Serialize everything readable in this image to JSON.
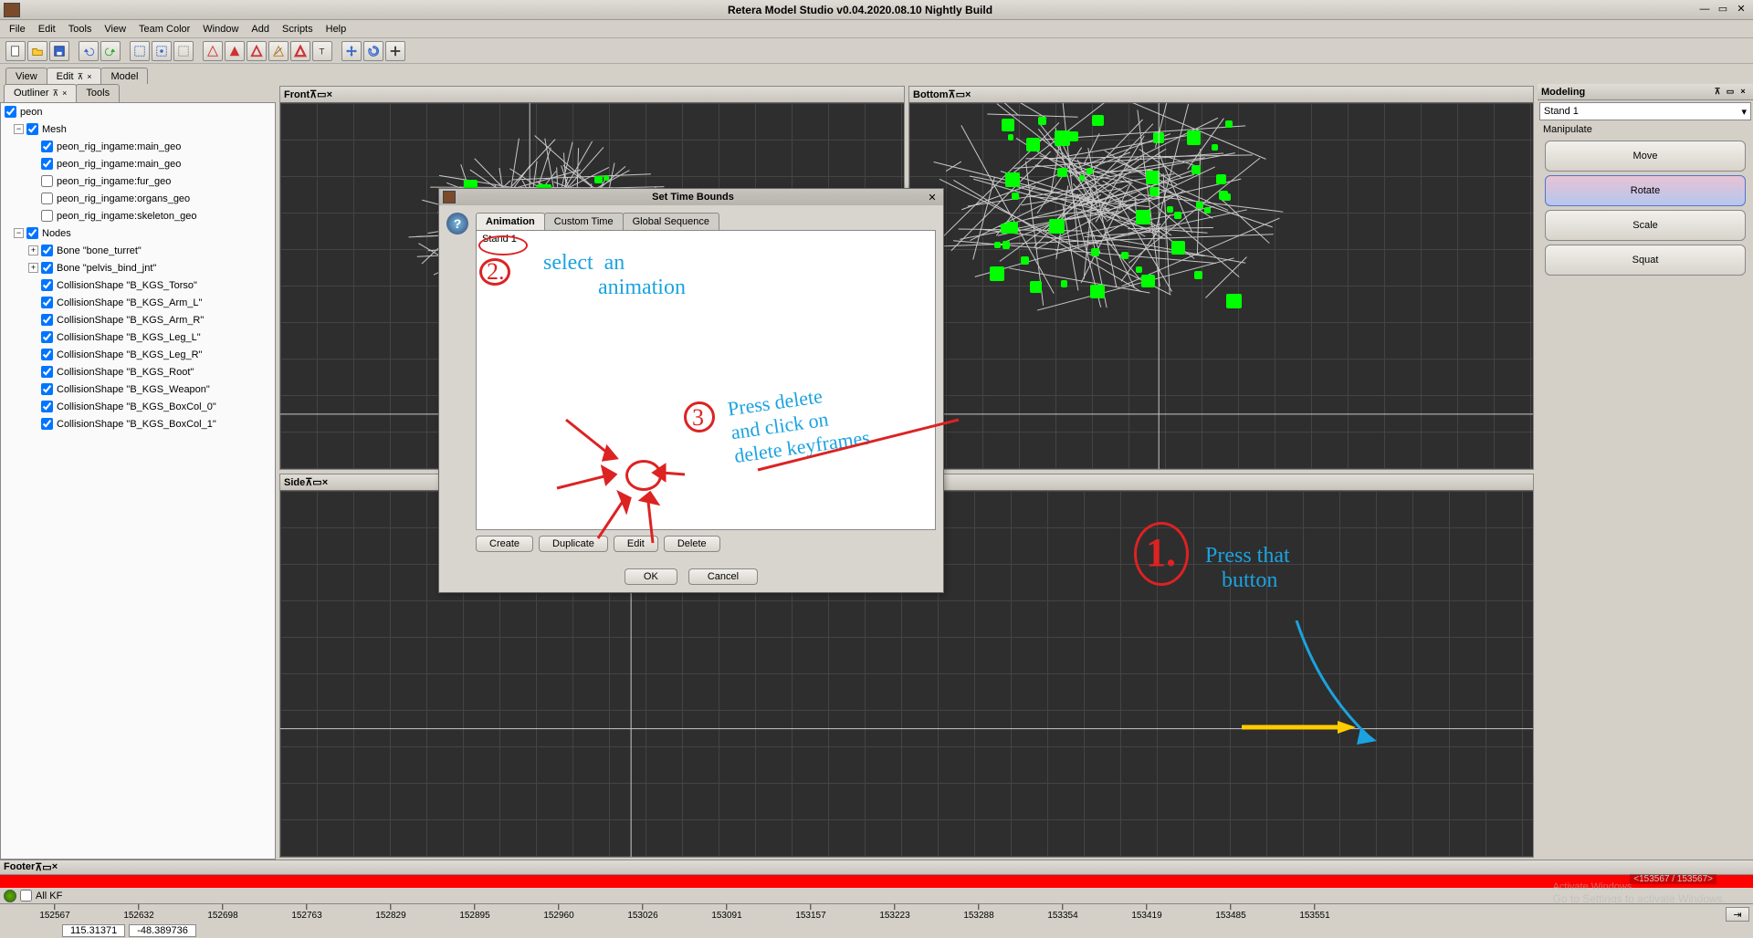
{
  "title": "Retera Model Studio v0.04.2020.08.10 Nightly Build",
  "menu": [
    "File",
    "Edit",
    "Tools",
    "View",
    "Team Color",
    "Window",
    "Add",
    "Scripts",
    "Help"
  ],
  "topTabs": {
    "view": "View",
    "edit": "Edit",
    "model": "Model"
  },
  "leftTabs": {
    "outliner": "Outliner",
    "tools": "Tools"
  },
  "outliner": {
    "root": "peon",
    "mesh": "Mesh",
    "meshItems": [
      "peon_rig_ingame:main_geo",
      "peon_rig_ingame:main_geo",
      "peon_rig_ingame:fur_geo",
      "peon_rig_ingame:organs_geo",
      "peon_rig_ingame:skeleton_geo"
    ],
    "meshChecked": [
      true,
      true,
      false,
      false,
      false
    ],
    "nodes": "Nodes",
    "nodeItems": [
      "Bone \"bone_turret\"",
      "Bone \"pelvis_bind_jnt\"",
      "CollisionShape \"B_KGS_Torso\"",
      "CollisionShape \"B_KGS_Arm_L\"",
      "CollisionShape \"B_KGS_Arm_R\"",
      "CollisionShape \"B_KGS_Leg_L\"",
      "CollisionShape \"B_KGS_Leg_R\"",
      "CollisionShape \"B_KGS_Root\"",
      "CollisionShape \"B_KGS_Weapon\"",
      "CollisionShape \"B_KGS_BoxCol_0\"",
      "CollisionShape \"B_KGS_BoxCol_1\""
    ],
    "nodeExpand": [
      true,
      true,
      false,
      false,
      false,
      false,
      false,
      false,
      false,
      false,
      false
    ]
  },
  "viewports": {
    "front": "Front",
    "bottom": "Bottom",
    "side": "Side"
  },
  "modeling": {
    "title": "Modeling",
    "anim": "Stand 1",
    "group": "Manipulate",
    "buttons": [
      "Move",
      "Rotate",
      "Scale",
      "Squat"
    ],
    "active": 1
  },
  "footer": {
    "title": "Footer",
    "allkf": "All KF",
    "ticks": [
      "152567",
      "152632",
      "152698",
      "152763",
      "152829",
      "152895",
      "152960",
      "153026",
      "153091",
      "153157",
      "153223",
      "153288",
      "153354",
      "153419",
      "153485",
      "153551"
    ],
    "range": "<153567 / 153567>",
    "coord1": "115.31371",
    "coord2": "-48.389736"
  },
  "dialog": {
    "title": "Set Time Bounds",
    "tabs": [
      "Animation",
      "Custom Time",
      "Global Sequence"
    ],
    "item": "Stand 1",
    "actions": [
      "Create",
      "Duplicate",
      "Edit",
      "Delete"
    ],
    "ok": "OK",
    "cancel": "Cancel"
  },
  "anno": {
    "s2": "2.",
    "s2t": "select  an\n          animation",
    "s3": "3",
    "s3t": "Press delete\nand click on\ndelete keyframes",
    "s1": "1.",
    "s1t": "Press that\n   button"
  },
  "watermark": {
    "title": "Activate Windows",
    "sub": "Go to Settings to activate Windows."
  }
}
